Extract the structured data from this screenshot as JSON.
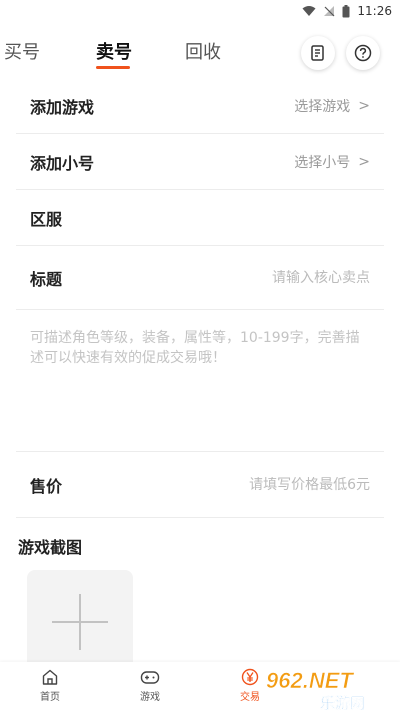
{
  "status_bar": {
    "time": "11:26"
  },
  "tabs": [
    {
      "label": "买号",
      "active": false
    },
    {
      "label": "卖号",
      "active": true
    },
    {
      "label": "回收",
      "active": false
    }
  ],
  "header_icons": [
    "list-doc-icon",
    "help-icon"
  ],
  "form": {
    "game": {
      "label": "添加游戏",
      "value": "选择游戏",
      "chevron": ">"
    },
    "account": {
      "label": "添加小号",
      "value": "选择小号",
      "chevron": ">"
    },
    "server": {
      "label": "区服"
    },
    "title": {
      "label": "标题",
      "placeholder": "请输入核心卖点"
    },
    "description": {
      "placeholder": "可描述角色等级，装备，属性等，10-199字，完善描述可以快速有效的促成交易哦！"
    },
    "price": {
      "label": "售价",
      "placeholder": "请填写价格最低6元"
    }
  },
  "screenshots": {
    "title": "游戏截图"
  },
  "bottom_nav": [
    {
      "label": "首页",
      "icon": "home-icon",
      "active": false
    },
    {
      "label": "游戏",
      "icon": "gamepad-icon",
      "active": false
    },
    {
      "label": "交易",
      "icon": "yen-coin-icon",
      "active": true
    }
  ],
  "watermark": {
    "brand": "962.NET",
    "subtitle": "乐游网"
  },
  "colors": {
    "accent": "#f0521c",
    "watermark_orange": "#f39c12",
    "watermark_blue": "#1e88e5"
  }
}
